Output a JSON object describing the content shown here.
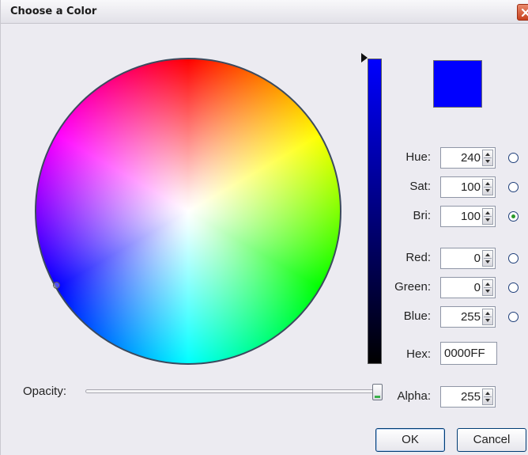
{
  "window": {
    "title": "Choose a Color"
  },
  "color": {
    "current_hex_color": "#0000ff",
    "brightness_level_fraction": 1.0,
    "opacity_level_fraction": 1.0
  },
  "fields": {
    "hue": {
      "label": "Hue:",
      "value": "240",
      "selected": false
    },
    "sat": {
      "label": "Sat:",
      "value": "100",
      "selected": false
    },
    "bri": {
      "label": "Bri:",
      "value": "100",
      "selected": true
    },
    "red": {
      "label": "Red:",
      "value": "0",
      "selected": false
    },
    "green": {
      "label": "Green:",
      "value": "0",
      "selected": false
    },
    "blue": {
      "label": "Blue:",
      "value": "255",
      "selected": false
    }
  },
  "hex": {
    "label": "Hex:",
    "value": "0000FF"
  },
  "opacity": {
    "label": "Opacity:"
  },
  "alpha": {
    "label": "Alpha:",
    "value": "255"
  },
  "buttons": {
    "ok": "OK",
    "cancel": "Cancel"
  },
  "icons": {
    "close": "close-icon",
    "spinner_up": "spinner-up-icon",
    "spinner_down": "spinner-down-icon",
    "brightness_pointer": "triangle-right-icon"
  }
}
